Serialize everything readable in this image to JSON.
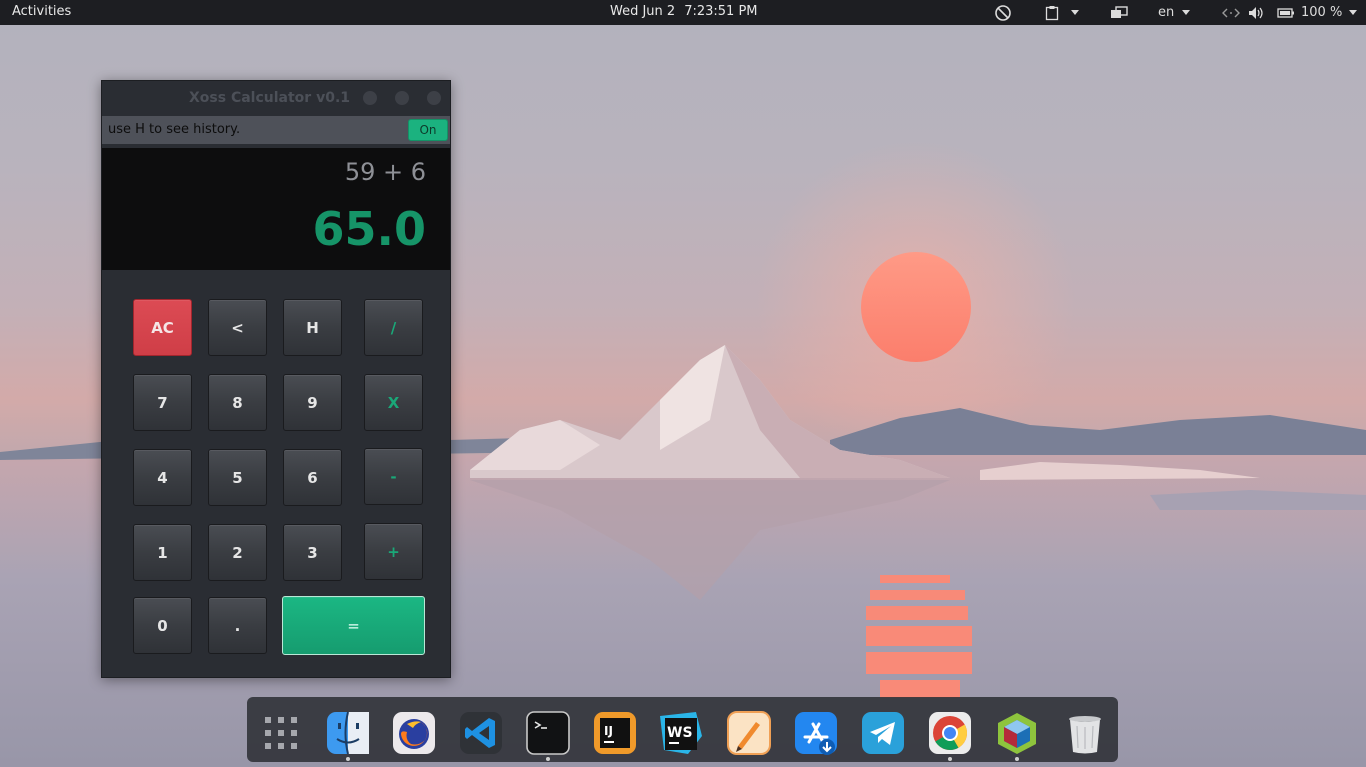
{
  "topbar": {
    "activities": "Activities",
    "date": "Wed Jun 2",
    "time": "7:23:51 PM",
    "language": "en",
    "battery": "100 %",
    "icons": [
      "do-not-disturb-icon",
      "clipboard-icon",
      "display-icon",
      "network-icon",
      "volume-icon",
      "battery-icon"
    ]
  },
  "calculator": {
    "title": "Xoss Calculator v0.1",
    "hint": "use H to see history.",
    "toggle_label": "On",
    "expression": "59 + 6",
    "result": "65.0",
    "keys": {
      "ac": "AC",
      "back": "<",
      "history": "H",
      "divide": "/",
      "seven": "7",
      "eight": "8",
      "nine": "9",
      "multiply": "X",
      "four": "4",
      "five": "5",
      "six": "6",
      "minus": "-",
      "one": "1",
      "two": "2",
      "three": "3",
      "plus": "+",
      "zero": "0",
      "dot": ".",
      "equals": "="
    },
    "colors": {
      "accent": "#1bb27f",
      "clear": "#d7454e",
      "result": "#169468"
    }
  },
  "dock": {
    "apps": [
      "show-applications-icon",
      "finder-icon",
      "firefox-icon",
      "vscode-icon",
      "terminal-icon",
      "intellij-icon",
      "webstorm-icon",
      "sketch-pen-icon",
      "app-store-icon",
      "telegram-icon",
      "chrome-icon",
      "virtualbox-icon",
      "trash-icon"
    ],
    "running": [
      "finder-icon",
      "terminal-icon",
      "chrome-icon",
      "virtualbox-icon"
    ]
  }
}
